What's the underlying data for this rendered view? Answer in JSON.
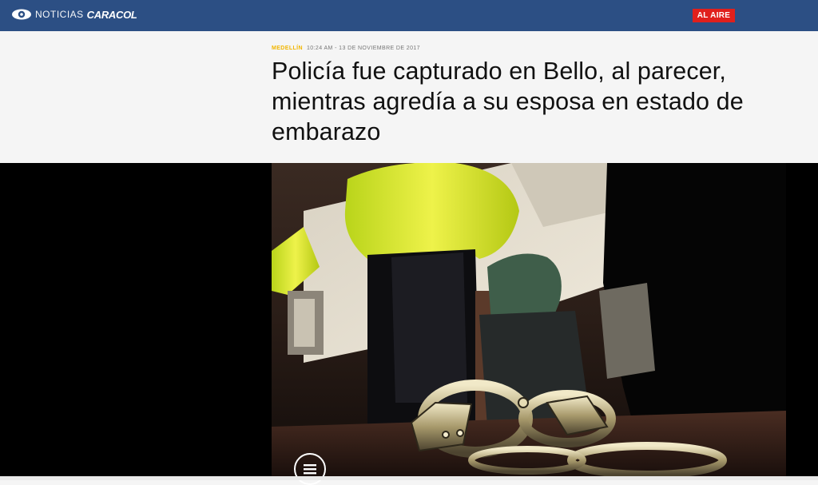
{
  "header": {
    "logo_prefix": "NOTICIAS",
    "logo_brand": "CARACOL",
    "live_label": "AL AIRE",
    "brand_color": "#2c4f84",
    "live_color": "#e0201c"
  },
  "article": {
    "category": "MEDELLÍN",
    "timestamp": "10:24 AM - 13 DE NOVIEMBRE DE 2017",
    "headline": "Policía fue capturado en Bello, al parecer, mientras agredía a su esposa en estado de embarazo",
    "category_color": "#f2b600"
  },
  "media": {
    "image_subject": "handcuffs-on-table-with-officers-in-yellow-jackets",
    "button_icon": "menu-list-icon"
  }
}
